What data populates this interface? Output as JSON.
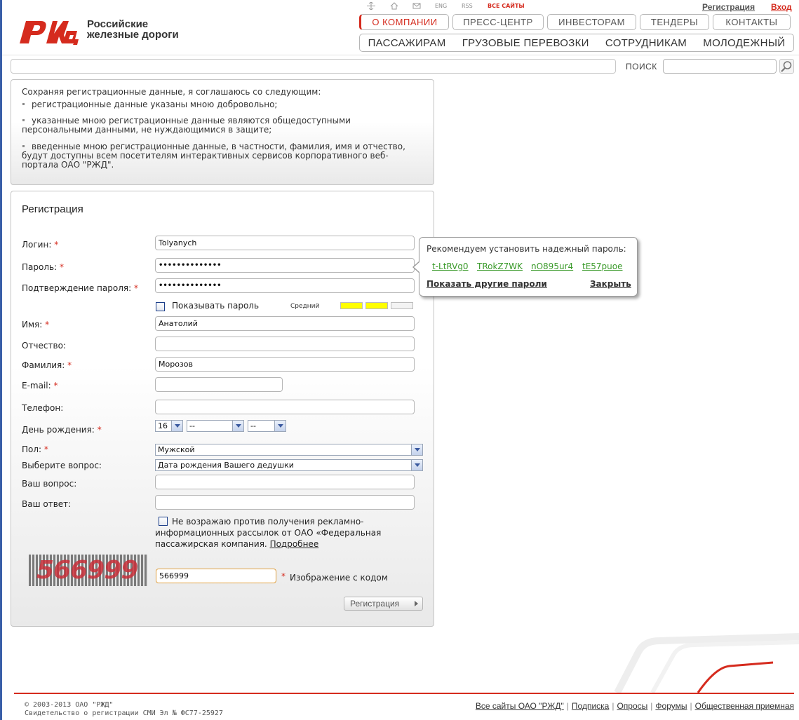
{
  "logo": {
    "abbr": "РЖД",
    "line1": "Российские",
    "line2": "железные дороги"
  },
  "top_links": {
    "eng": "ENG",
    "rss": "RSS",
    "all_sites": "ВСЕ САЙТЫ",
    "register": "Регистрация",
    "login": "Вход"
  },
  "nav_tabs": [
    "О КОМПАНИИ",
    "ПРЕСС-ЦЕНТР",
    "ИНВЕСТОРАМ",
    "ТЕНДЕРЫ",
    "КОНТАКТЫ"
  ],
  "nav_sections": [
    "ПАССАЖИРАМ",
    "ГРУЗОВЫЕ ПЕРЕВОЗКИ",
    "СОТРУДНИКАМ",
    "МОЛОДЕЖНЫЙ"
  ],
  "search": {
    "label": "ПОИСК",
    "value": ""
  },
  "info": {
    "intro": "Сохраняя регистрационные данные, я соглашаюсь со следующим:",
    "items": [
      "регистрационные данные указаны мною добровольно;",
      "указанные мною регистрационные данные являются общедоступными персональными данными, не нуждающимися в защите;",
      "введенные мною регистрационные данные, в частности, фамилия, имя и отчество, будут доступны всем посетителям интерактивных сервисов корпоративного веб-портала ОАО \"РЖД\"."
    ]
  },
  "form": {
    "title": "Регистрация",
    "required_mark": "*",
    "login": {
      "label": "Логин:",
      "value": "Tolyanych"
    },
    "password": {
      "label": "Пароль:",
      "value": "••••••••••••••"
    },
    "confirm": {
      "label": "Подтверждение пароля:",
      "value": "••••••••••••••"
    },
    "show_password": "Показывать пароль",
    "strength": {
      "label": "Средний",
      "level": 2,
      "max": 3,
      "fill_color": "#ffff00"
    },
    "first_name": {
      "label": "Имя:",
      "value": "Анатолий"
    },
    "middle_name": {
      "label": "Отчество:",
      "value": ""
    },
    "last_name": {
      "label": "Фамилия:",
      "value": "Морозов"
    },
    "email": {
      "label": "E-mail:",
      "value": ""
    },
    "phone": {
      "label": "Телефон:",
      "value": ""
    },
    "birthday": {
      "label": "День рождения:",
      "day": "16",
      "month": "--",
      "year": "--"
    },
    "gender": {
      "label": "Пол:",
      "value": "Мужской"
    },
    "question_select": {
      "label": "Выберите вопрос:",
      "value": "Дата рождения Вашего дедушки"
    },
    "own_question": {
      "label": "Ваш вопрос:",
      "value": ""
    },
    "answer": {
      "label": "Ваш ответ:",
      "value": ""
    },
    "mailing": {
      "text": "Не возражаю против получения рекламно-информационных рассылок от ОАО «Федеральная пассажирская компания.",
      "more": "Подробнее"
    },
    "captcha": {
      "image_text": "566999",
      "value": "566999",
      "label": "Изображение с кодом"
    },
    "submit": "Регистрация"
  },
  "tooltip": {
    "title": "Рекомендуем установить надежный пароль:",
    "passwords": [
      "t-LtRVg0",
      "TRokZ7WK",
      "nO895ur4",
      "tE57puoe"
    ],
    "more": "Показать другие пароли",
    "close": "Закрыть"
  },
  "footer": {
    "copyright": "© 2003-2013 ОАО \"РЖД\"",
    "certificate": "Свидетельство о регистрации СМИ Эл № ФС77-25927",
    "links": [
      "Все сайты ОАО \"РЖД\"",
      "Подписка",
      "Опросы",
      "Форумы",
      "Общественная приемная"
    ]
  },
  "colors": {
    "brand_red": "#d52b1e",
    "suggest_green": "#3a9a2a"
  }
}
